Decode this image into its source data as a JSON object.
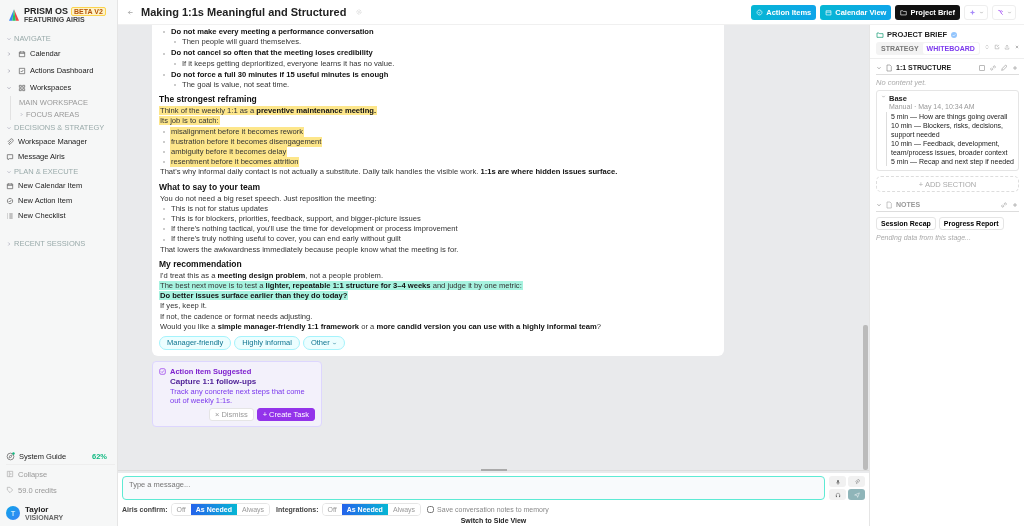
{
  "sidebar": {
    "brand": {
      "name": "PRISM OS",
      "badge": "BETA V2",
      "tagline": "FEATURING AIRIS"
    },
    "sections": [
      {
        "title": "NAVIGATE",
        "expanded": true,
        "items": [
          {
            "label": "Calendar",
            "expanded": false
          },
          {
            "label": "Actions Dashboard",
            "expanded": false
          },
          {
            "label": "Workspaces",
            "expanded": true,
            "children": [
              {
                "label": "MAIN WORKSPACE"
              },
              {
                "label": "FOCUS AREAS",
                "expanded": false
              }
            ]
          }
        ]
      },
      {
        "title": "DECISIONS & STRATEGY",
        "expanded": true,
        "items": [
          {
            "label": "Workspace Manager"
          },
          {
            "label": "Message Airis"
          }
        ]
      },
      {
        "title": "PLAN & EXECUTE",
        "expanded": true,
        "items": [
          {
            "label": "New Calendar Item"
          },
          {
            "label": "New Action Item"
          },
          {
            "label": "New Checklist"
          }
        ]
      },
      {
        "title": "RECENT SESSIONS",
        "expanded": false
      }
    ],
    "guide": {
      "label": "System Guide",
      "value": "62%"
    },
    "collapse": "Collapse",
    "credits": "59.0 credits",
    "user": {
      "initial": "T",
      "name": "Taylor",
      "role": "VISIONARY"
    }
  },
  "header": {
    "title": "Making 1:1s Meaningful and Structured",
    "buttons": [
      {
        "label": "Action Items",
        "kind": "accent"
      },
      {
        "label": "Calendar View",
        "kind": "accent"
      },
      {
        "label": "Project Brief",
        "kind": "dark"
      }
    ]
  },
  "document": {
    "blocks": [
      {
        "kind": "bullet",
        "text": "Do not make every meeting a performance conversation",
        "bold": true,
        "children": [
          {
            "text": "Then people will guard themselves."
          }
        ]
      },
      {
        "kind": "bullet",
        "text": "Do not cancel so often that the meeting loses credibility",
        "bold": true,
        "children": [
          {
            "text": "If it keeps getting deprioritized, everyone learns it has no value."
          }
        ]
      },
      {
        "kind": "bullet",
        "text": "Do not force a full 30 minutes if 15 useful minutes is enough",
        "bold": true,
        "children": [
          {
            "text": "The goal is value, not seat time."
          }
        ]
      },
      {
        "kind": "heading",
        "text": "The strongest reframing"
      },
      {
        "kind": "para",
        "text": "Think of the weekly 1:1 as a **preventive maintenance meeting.**",
        "color": "#fde68a"
      },
      {
        "kind": "para",
        "text": "Its job is to catch:",
        "color": "#fde68a"
      },
      {
        "kind": "bullet",
        "text": "misalignment before it becomes rework",
        "color": "#fde68a"
      },
      {
        "kind": "bullet",
        "text": "frustration before it becomes disengagement",
        "color": "#fde68a"
      },
      {
        "kind": "bullet",
        "text": "ambiguity before it becomes delay",
        "color": "#fde68a"
      },
      {
        "kind": "bullet",
        "text": "resentment before it becomes attrition",
        "color": "#fde68a"
      },
      {
        "kind": "para",
        "text": "That's why informal daily contact is not actually a substitute. Daily talk handles the visible work. **1:1s are where hidden issues surface.**"
      },
      {
        "kind": "heading",
        "text": "What to say to your team"
      },
      {
        "kind": "para",
        "text": "You do not need a big reset speech. Just reposition the meeting:"
      },
      {
        "kind": "bullet",
        "text": "This is not for status updates"
      },
      {
        "kind": "bullet",
        "text": "This is for blockers, priorities, feedback, support, and bigger-picture issues"
      },
      {
        "kind": "bullet",
        "text": "If there's nothing tactical, you'll use the time for development or process improvement"
      },
      {
        "kind": "bullet",
        "text": "If there's truly nothing useful to cover, you can end early without guilt"
      },
      {
        "kind": "para",
        "text": "That lowers the awkwardness immediately because people know what the meeting is for."
      },
      {
        "kind": "heading",
        "text": "My recommendation"
      },
      {
        "kind": "para",
        "text": "I'd treat this as a **meeting design problem**, not a people problem."
      },
      {
        "kind": "para",
        "text": "The best next move is to test a **lighter, repeatable 1:1 structure for 3–4 weeks** and judge it by one metric:",
        "color": "#a7f3e0"
      },
      {
        "kind": "para",
        "text": "**Do better issues surface earlier than they do today?**",
        "color": "#a7f3e0"
      },
      {
        "kind": "para",
        "text": "If yes, keep it."
      },
      {
        "kind": "para",
        "text": "If not, the cadence or format needs adjusting."
      },
      {
        "kind": "para",
        "text": "Would you like a **simple manager-friendly 1:1 framework** or a **more candid version you can use with a highly informal team**?"
      }
    ],
    "chips": [
      {
        "label": "Manager-friendly",
        "kind": "plain"
      },
      {
        "label": "Highly informal",
        "kind": "plain"
      },
      {
        "label": "Other",
        "kind": "menu"
      }
    ]
  },
  "suggestion": {
    "title": "Action Item Suggested",
    "task": "Capture 1:1 follow-ups",
    "description": "Track any concrete next steps that come out of weekly 1:1s.",
    "buttons": [
      {
        "label": "× Dismiss",
        "kind": "secondary"
      },
      {
        "label": "+ Create Task",
        "kind": "primary"
      }
    ]
  },
  "composer": {
    "placeholder": "Type a message...",
    "groups": [
      {
        "label": "Airis confirm:",
        "options": [
          {
            "label": "Off",
            "selected": false
          },
          {
            "label": "As Needed",
            "selected": true
          },
          {
            "label": "Always",
            "selected": false
          }
        ]
      },
      {
        "label": "Integrations:",
        "options": [
          {
            "label": "Off",
            "selected": false
          },
          {
            "label": "As Needed",
            "selected": true
          },
          {
            "label": "Always",
            "selected": false
          }
        ]
      }
    ],
    "memory": {
      "label": "Save conversation notes to memory",
      "checked": false
    },
    "switch_view": "Switch to Side View"
  },
  "brief": {
    "title": "PROJECT BRIEF",
    "tabs": [
      {
        "label": "STRATEGY",
        "selected": false
      },
      {
        "label": "WHITEBOARD",
        "selected": true
      }
    ],
    "sections": [
      {
        "title": "1:1 STRUCTURE",
        "expanded": true,
        "empty_note": "No content yet.",
        "entries": [
          {
            "title": "Base",
            "meta": "Manual · May 14, 10:34 AM",
            "expanded": true,
            "lines": [
              "5 min — How are things going overall",
              "10 min — Blockers, risks, decisions, support needed",
              "10 min — Feedback, development, team/process issues, broader context",
              "5 min — Recap and next step if needed"
            ]
          }
        ]
      }
    ],
    "add_section": "+ ADD SECTION",
    "notes": {
      "title": "NOTES",
      "expanded": true,
      "buttons": [
        "Session Recap",
        "Progress Report"
      ],
      "status": "Pending data from this stage..."
    }
  }
}
